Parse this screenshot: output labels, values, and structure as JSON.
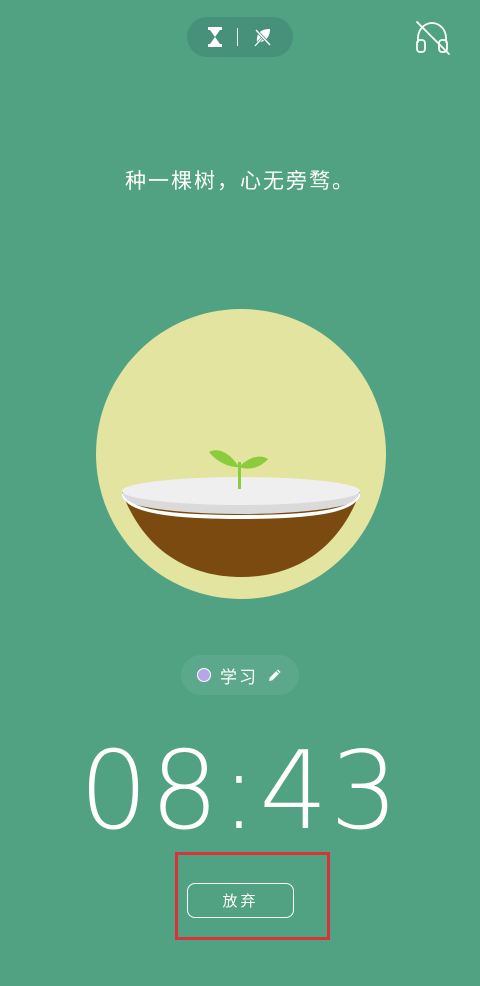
{
  "header": {
    "modes": [
      {
        "icon": "hourglass-icon"
      },
      {
        "icon": "leaf-off-icon"
      }
    ],
    "headphone_icon": "headphone-off-icon"
  },
  "slogan": "种一棵树，心无旁骛。",
  "tree": {
    "stage": "sprout",
    "circle_color": "#e3e4a0",
    "soil_color": "#7a4a10",
    "leaf_color": "#8ccb3c"
  },
  "tag": {
    "label": "学习",
    "color": "#b6a6e6",
    "edit_icon": "pencil-icon"
  },
  "timer": "08:43",
  "give_up_label": "放弃",
  "colors": {
    "background": "#51a283",
    "highlight": "#d9333a"
  }
}
